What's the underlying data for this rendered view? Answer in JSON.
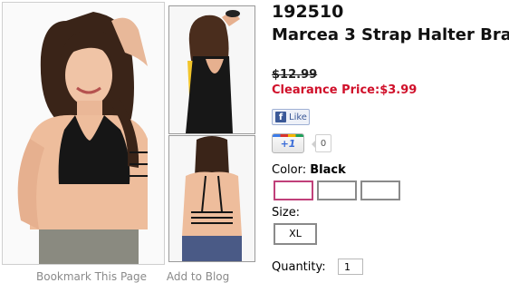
{
  "product": {
    "sku": "192510",
    "name": "Marcea 3 Strap Halter Bra",
    "original_price": "$12.99",
    "clearance_price": "Clearance Price:$3.99"
  },
  "social": {
    "facebook_icon": "f",
    "facebook_label": "Like",
    "gplus_label": "+1",
    "gplus_count": "0"
  },
  "options": {
    "color_label": "Color:",
    "color_value": "Black",
    "swatches": [
      {
        "selected": true,
        "color": "#ffffff"
      },
      {
        "selected": false,
        "color": "#ffffff"
      },
      {
        "selected": false,
        "color": "#ffffff"
      }
    ],
    "size_label": "Size:",
    "size_value": "XL",
    "quantity_label": "Quantity:",
    "quantity_value": "1"
  },
  "links": {
    "bookmark": "Bookmark This Page",
    "add_to_blog": "Add to Blog"
  },
  "colors": {
    "sale_red": "#d0102a",
    "selected_swatch_border": "#c0407a",
    "facebook_blue": "#3b5998"
  }
}
